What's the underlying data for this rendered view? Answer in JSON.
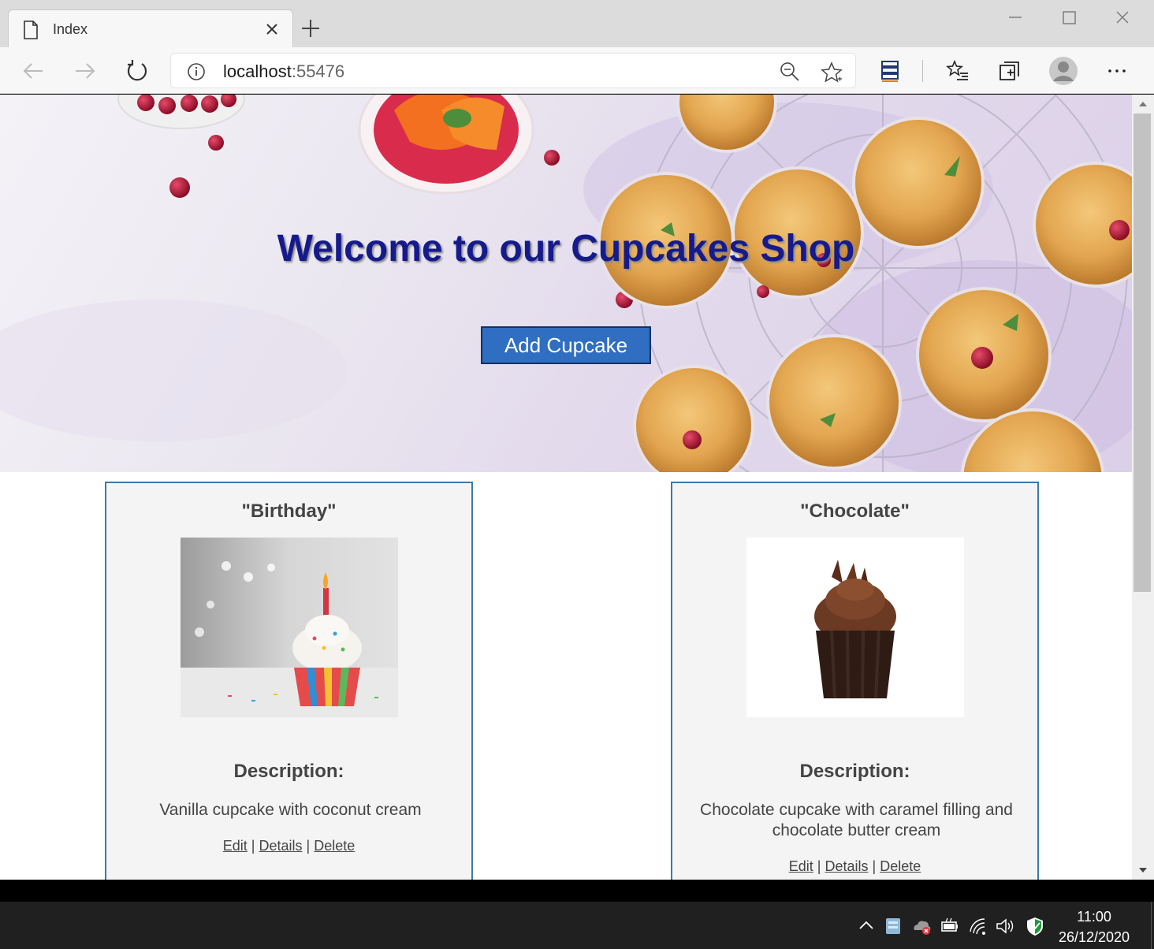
{
  "browser": {
    "tab_title": "Index",
    "url_host": "localhost",
    "url_port": ":55476"
  },
  "hero": {
    "title": "Welcome to our Cupcakes Shop",
    "button_label": "Add Cupcake"
  },
  "cards": [
    {
      "name": "\"Birthday\"",
      "description_label": "Description:",
      "description": "Vanilla cupcake with coconut cream",
      "edit": "Edit",
      "details": "Details",
      "delete": "Delete",
      "separator": "|"
    },
    {
      "name": "\"Chocolate\"",
      "description_label": "Description:",
      "description": "Chocolate cupcake with caramel filling and chocolate butter cream",
      "edit": "Edit",
      "details": "Details",
      "delete": "Delete",
      "separator": "|"
    }
  ],
  "taskbar": {
    "time": "11:00",
    "date": "26/12/2020"
  },
  "colors": {
    "hero_title": "#151a8c",
    "button_bg": "#2f6ec0",
    "card_border": "#3b7aa7"
  }
}
